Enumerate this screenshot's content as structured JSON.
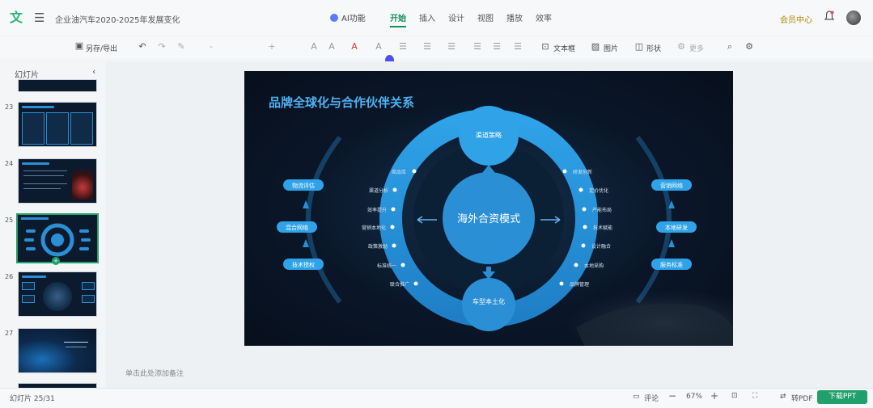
{
  "app": {
    "logo_glyph": "文",
    "doc_title": "企业油汽车2020-2025年发展变化",
    "ai_label": "AI功能",
    "tabs": [
      "开始",
      "插入",
      "设计",
      "视图",
      "播放",
      "效率"
    ],
    "active_tab": "开始",
    "vip_label": "会员中心"
  },
  "toolbar": {
    "save_export": "另存/导出",
    "text_box": "文本框",
    "image": "图片",
    "shape": "形状",
    "more": "更多"
  },
  "sidebar": {
    "title": "幻灯片",
    "slide_numbers": [
      "23",
      "24",
      "25",
      "26",
      "27"
    ],
    "selected_slide": "25",
    "badge": "+"
  },
  "slide": {
    "title": "品牌全球化与合作伙伴关系",
    "center": "海外合资模式",
    "top_node": "渠道策略",
    "bottom_node": "车型本土化",
    "left_pills": [
      "物流评估",
      "混合网络",
      "技术授权"
    ],
    "right_pills": [
      "营销网络",
      "本地研发",
      "服务标准"
    ],
    "left_labels": [
      "商品库",
      "渠道分析",
      "效率提升",
      "营销本地化",
      "政策激励",
      "标准统一",
      "联合推广"
    ],
    "right_labels": [
      "研发创新",
      "定价优化",
      "产能布局",
      "技术赋能",
      "设计融合",
      "本地采购",
      "品牌管理"
    ]
  },
  "notes_placeholder": "单击此处添加备注",
  "status": {
    "slide_counter": "幻灯片 25/31",
    "comment": "评论",
    "zoom": "67%",
    "export_pdf": "转PDF",
    "download": "下载PPT"
  },
  "colors": {
    "accent": "#22a06b",
    "slide_blue": "#2b8fd6",
    "slide_bg": "#0a1628"
  }
}
